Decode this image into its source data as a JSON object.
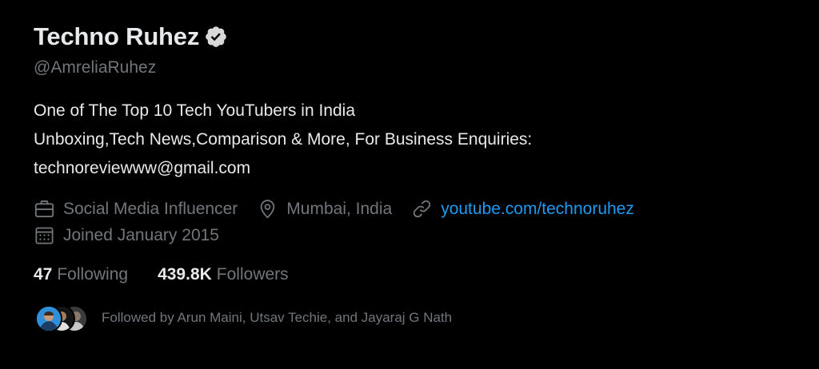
{
  "profile": {
    "display_name": "Techno Ruhez",
    "handle": "@AmreliaRuhez",
    "verified_icon": "verified-badge-icon"
  },
  "bio": {
    "line1": "One of The Top 10 Tech YouTubers in India",
    "line2": "Unboxing,Tech News,Comparison & More, For Business Enquiries:",
    "line3": "technoreviewww@gmail.com"
  },
  "meta": {
    "category": "Social Media Influencer",
    "location": "Mumbai, India",
    "website": "youtube.com/technoruhez",
    "joined": "Joined January 2015",
    "icons": [
      "briefcase-icon",
      "location-pin-icon",
      "link-icon",
      "calendar-icon"
    ]
  },
  "stats": {
    "following_count": "47",
    "following_label": "Following",
    "followers_count": "439.8K",
    "followers_label": "Followers"
  },
  "followed_by": {
    "text": "Followed by Arun Maini, Utsav Techie, and Jayaraj G Nath"
  },
  "colors": {
    "background": "#000000",
    "primary_text": "#e7e9ea",
    "secondary_text": "#71767b",
    "link": "#1d9bf0",
    "verified_badge": "#d9d9d9"
  }
}
